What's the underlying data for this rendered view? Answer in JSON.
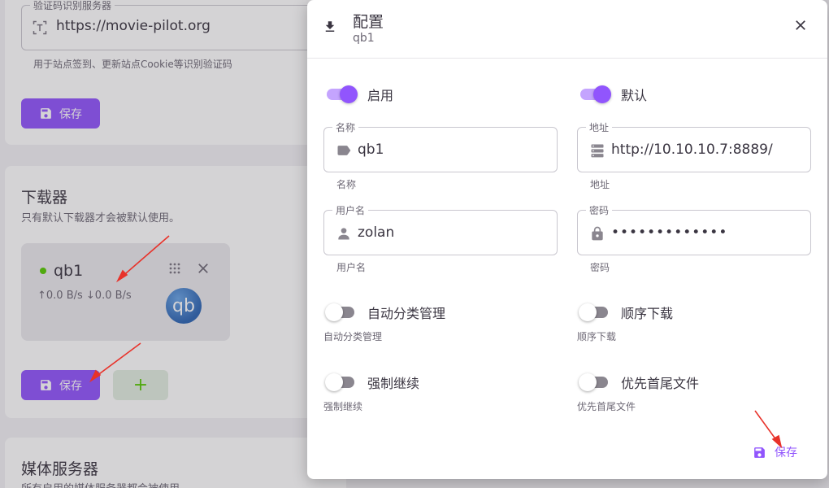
{
  "background": {
    "captcha_server": {
      "legend": "验证码识别服务器",
      "value": "https://movie-pilot.org",
      "hint": "用于站点签到、更新站点Cookie等识别验证码",
      "save_label": "保存"
    },
    "downloaders": {
      "title": "下载器",
      "subtitle": "只有默认下载器才会被默认使用。",
      "card": {
        "name": "qb1",
        "speed": "↑0.0 B/s ↓0.0 B/s",
        "logo_text": "qb",
        "status_color": "#56ca00"
      },
      "save_label": "保存",
      "add_label": "+"
    },
    "media_servers": {
      "title": "媒体服务器",
      "subtitle": "所有启用的媒体服务器都会被使用。"
    }
  },
  "dialog": {
    "title": "配置",
    "subtitle": "qb1",
    "switches": {
      "enable": {
        "label": "启用",
        "on": true
      },
      "default": {
        "label": "默认",
        "on": true
      },
      "auto_category": {
        "label": "自动分类管理",
        "hint": "自动分类管理",
        "on": false
      },
      "sequential": {
        "label": "顺序下载",
        "hint": "顺序下载",
        "on": false
      },
      "force_resume": {
        "label": "强制继续",
        "hint": "强制继续",
        "on": false
      },
      "first_last": {
        "label": "优先首尾文件",
        "hint": "优先首尾文件",
        "on": false
      }
    },
    "fields": {
      "name": {
        "legend": "名称",
        "value": "qb1",
        "hint": "名称",
        "icon": "label-icon"
      },
      "host": {
        "legend": "地址",
        "value": "http://10.10.10.7:8889/",
        "hint": "地址",
        "icon": "server-icon"
      },
      "username": {
        "legend": "用户名",
        "value": "zolan",
        "hint": "用户名",
        "icon": "account-icon"
      },
      "password": {
        "legend": "密码",
        "value": "•••••••••••••",
        "hint": "密码",
        "icon": "lock-icon"
      }
    },
    "save_label": "保存"
  },
  "colors": {
    "primary": "#9155fd",
    "primary_light": "#c4a4fe",
    "success": "#56ca00",
    "annotation": "#e8322a"
  }
}
